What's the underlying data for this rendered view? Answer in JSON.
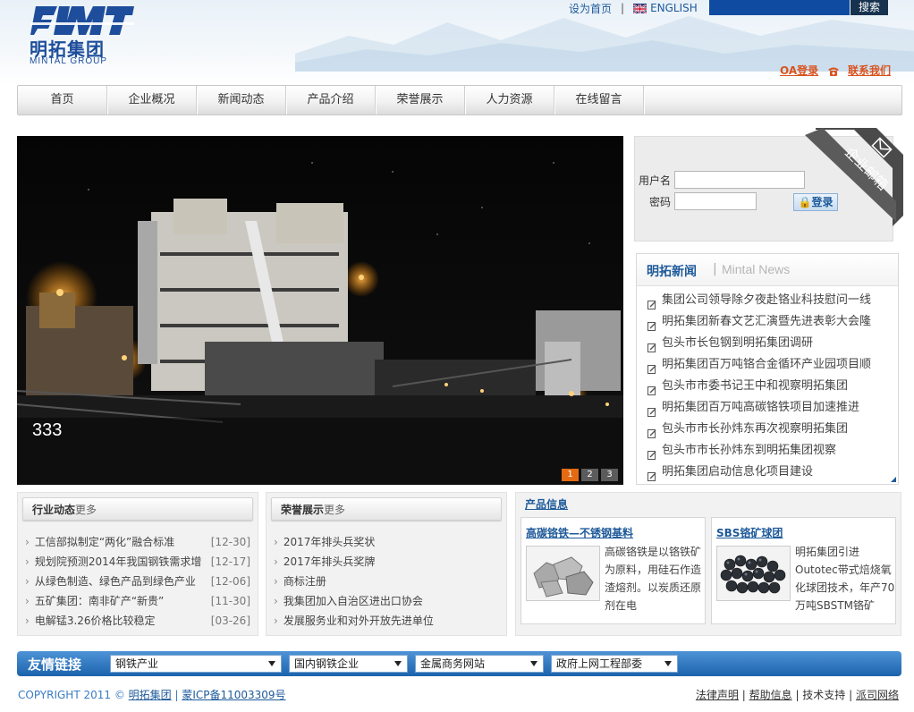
{
  "header": {
    "logo_cn": "明拓集团",
    "logo_en": "MINTAL GROUP",
    "set_home": "设为首页",
    "english": "ENGLISH",
    "search_button": "搜索",
    "oa_login": "OA登录",
    "contact_us": "联系我们"
  },
  "nav": {
    "items": [
      "首页",
      "企业概况",
      "新闻动态",
      "产品介绍",
      "荣誉展示",
      "人力资源",
      "在线留言"
    ]
  },
  "banner": {
    "caption": "333",
    "pages": [
      "1",
      "2",
      "3"
    ],
    "active_page": "1"
  },
  "login": {
    "username_label": "用户名",
    "password_label": "密码",
    "login_button": "登录",
    "ribbon_label": "企业邮箱"
  },
  "news": {
    "title_cn": "明拓新闻",
    "title_en": "Mintal News",
    "items": [
      "集团公司领导除夕夜赴铬业科技慰问一线",
      "明拓集团新春文艺汇演暨先进表彰大会隆",
      "包头市长包钢到明拓集团调研",
      "明拓集团百万吨铬合金循环产业园项目顺",
      "包头市市委书记王中和视察明拓集团",
      "明拓集团百万吨高碳铬铁项目加速推进",
      "包头市市长孙炜东再次视察明拓集团",
      "包头市市长孙炜东到明拓集团视察",
      "明拓集团启动信息化项目建设"
    ]
  },
  "industry": {
    "title": "行业动态",
    "more": "更多",
    "items": [
      {
        "text": "工信部拟制定“两化”融合标准",
        "date": "[12-30]"
      },
      {
        "text": "规划院预测2014年我国钢铁需求增",
        "date": "[12-17]"
      },
      {
        "text": "从绿色制造、绿色产品到绿色产业",
        "date": "[12-06]"
      },
      {
        "text": "五矿集团：南非矿产“新贵”",
        "date": "[11-30]"
      },
      {
        "text": "电解锰3.26价格比较稳定",
        "date": "[03-26]"
      }
    ]
  },
  "honors": {
    "title": "荣誉展示",
    "more": "更多",
    "items": [
      "2017年排头兵奖状",
      "2017年排头兵奖牌",
      "商标注册",
      "我集团加入自治区进出口协会",
      "发展服务业和对外开放先进单位"
    ]
  },
  "products": {
    "title": "产品信息",
    "cards": [
      {
        "title": "高碳铬铁—不锈钢基料",
        "desc": "高碳铬铁是以铬铁矿为原料，用硅石作造渣熔剂。以炭质还原剂在电"
      },
      {
        "title": "SBS铬矿球团",
        "desc": "明拓集团引进Outotec带式焙烧氧化球团技术，年产70万吨SBSTM铬矿"
      }
    ]
  },
  "links": {
    "label": "友情链接",
    "selects": [
      "钢铁产业",
      "国内钢铁企业",
      "金属商务网站",
      "政府上网工程部委"
    ]
  },
  "footer": {
    "copyright_prefix": "COPYRIGHT 2011 © ",
    "company_link": "明拓集团",
    "divider": " | ",
    "icp": "蒙ICP备11003309号",
    "right_links": [
      "法律声明",
      "帮助信息",
      "技术支持",
      "派司网络"
    ]
  },
  "colors": {
    "brand_blue": "#1e5a9a",
    "accent_orange": "#d9531e",
    "pager_active": "#e36a12"
  }
}
